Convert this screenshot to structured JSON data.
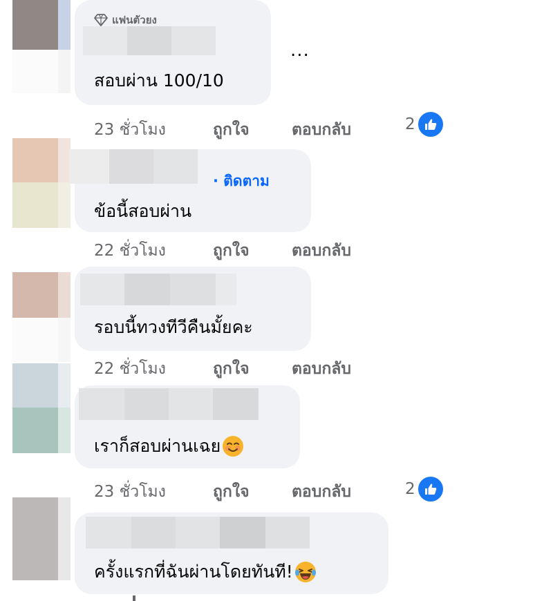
{
  "comments": [
    {
      "badge": "แฟนตัวยง",
      "text": "สอบผ่าน 100/10",
      "time": "23 ชั่วโมง",
      "like_label": "ถูกใจ",
      "reply_label": "ตอบกลับ",
      "reaction_count": "2",
      "more_label": "..."
    },
    {
      "follow_label": "· ติดตาม",
      "text": "ข้อนี้สอบผ่าน",
      "time": "22 ชั่วโมง",
      "like_label": "ถูกใจ",
      "reply_label": "ตอบกลับ"
    },
    {
      "text": "รอบนี้ทวงทีวีคืนมั้ยคะ",
      "time": "22 ชั่วโมง",
      "like_label": "ถูกใจ",
      "reply_label": "ตอบกลับ"
    },
    {
      "text": "เราก็สอบผ่านเฉย",
      "emoji": "smiling-face-emoji",
      "time": "23 ชั่วโมง",
      "like_label": "ถูกใจ",
      "reply_label": "ตอบกลับ",
      "reaction_count": "2"
    },
    {
      "text": "ครั้งแรกที่ฉันผ่านโดยทันที!",
      "emoji": "laughing-tears-emoji"
    }
  ],
  "colors": {
    "bubble": "#f0f2f5",
    "meta_text": "#65676b",
    "accent": "#1877f2",
    "follow": "#0866ff"
  },
  "icons": [
    "diamond-icon",
    "more-icon",
    "like-icon"
  ]
}
